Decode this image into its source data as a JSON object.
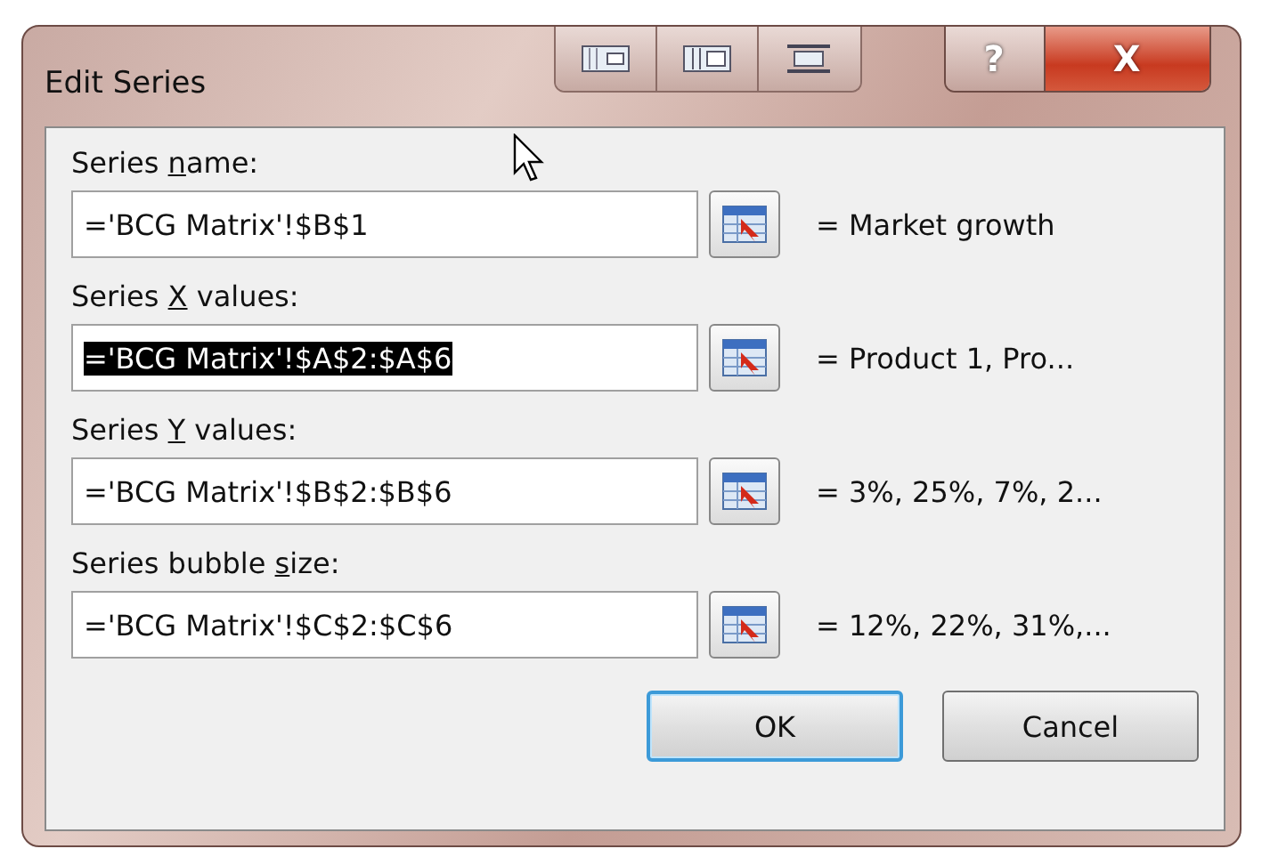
{
  "window": {
    "title": "Edit Series",
    "help_button": "?",
    "close_button": "X"
  },
  "fields": [
    {
      "label_start": "Series ",
      "access_key": "n",
      "label_end": "ame:",
      "value": "='BCG Matrix'!$B$1",
      "selected": false,
      "result": "= Market growth"
    },
    {
      "label_start": "Series ",
      "access_key": "X",
      "label_end": " values:",
      "value": "='BCG Matrix'!$A$2:$A$6",
      "selected": true,
      "result": "= Product 1, Pro..."
    },
    {
      "label_start": "Series ",
      "access_key": "Y",
      "label_end": " values:",
      "value": "='BCG Matrix'!$B$2:$B$6",
      "selected": false,
      "result": "= 3%, 25%, 7%, 2..."
    },
    {
      "label_start": "Series bubble ",
      "access_key": "s",
      "label_end": "ize:",
      "value": "='BCG Matrix'!$C$2:$C$6",
      "selected": false,
      "result": "= 12%, 22%, 31%,..."
    }
  ],
  "buttons": [
    {
      "label": "OK",
      "default": true
    },
    {
      "label": "Cancel",
      "default": false
    }
  ]
}
